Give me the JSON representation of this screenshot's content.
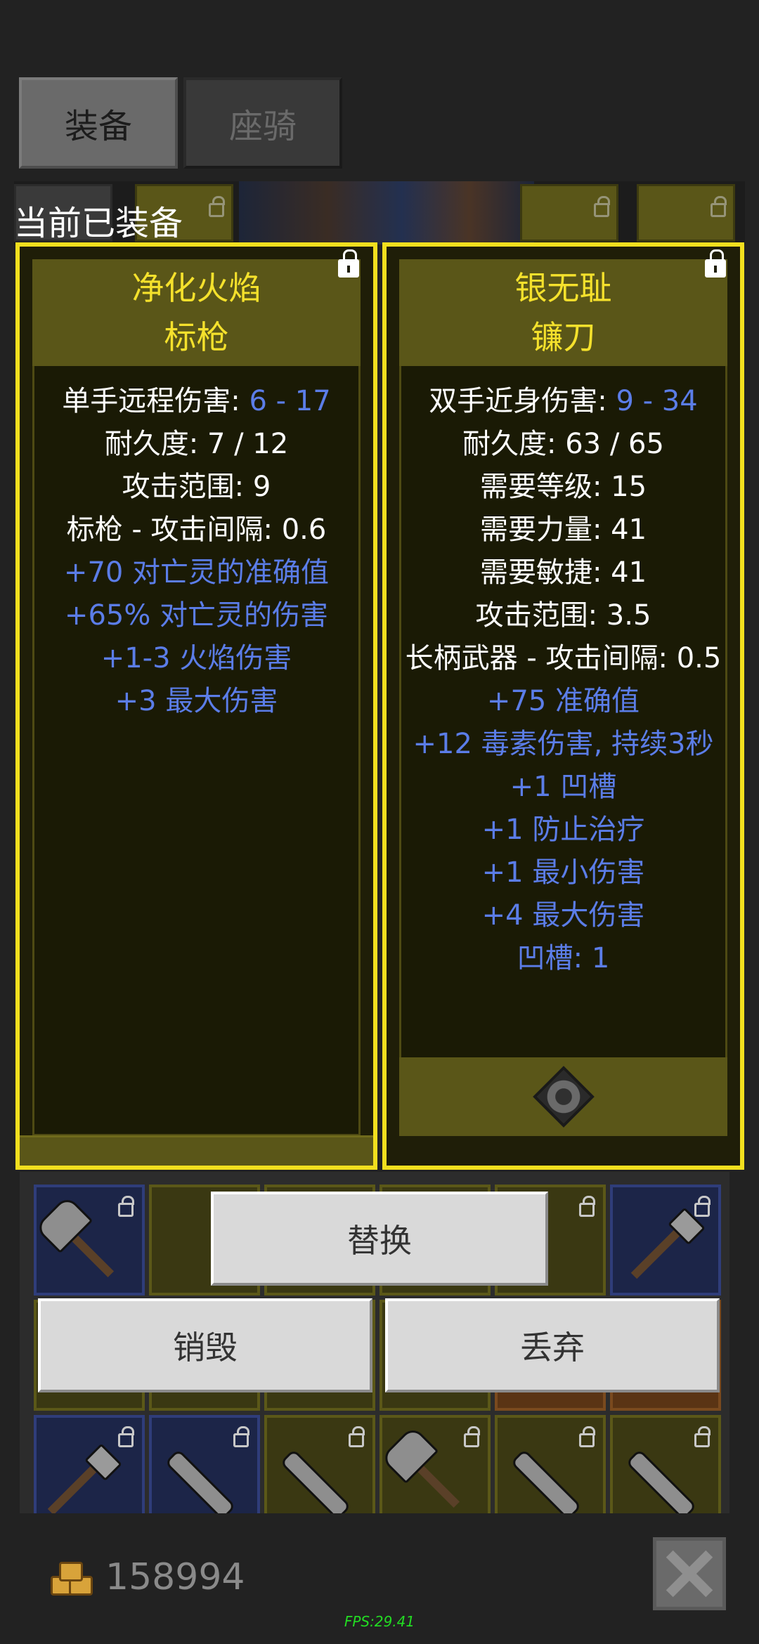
{
  "tabs": {
    "equipment": "装备",
    "mount": "座骑"
  },
  "current_equipped_label": "当前已装备",
  "left_item": {
    "name": "净化火焰",
    "type": "标枪",
    "stats": [
      {
        "label": "单手远程伤害: ",
        "value": "6 - 17"
      },
      {
        "label": "耐久度: 7 / 12"
      },
      {
        "label": "攻击范围: 9"
      },
      {
        "label": "标枪 - 攻击间隔: 0.6"
      }
    ],
    "bonuses": [
      "+70 对亡灵的准确值",
      "+65% 对亡灵的伤害",
      "+1-3 火焰伤害",
      "+3 最大伤害"
    ]
  },
  "right_item": {
    "name": "银无耻",
    "type": "镰刀",
    "stats": [
      {
        "label": "双手近身伤害: ",
        "value": "9 - 34"
      },
      {
        "label": "耐久度: 63 / 65"
      },
      {
        "label": "需要等级: 15"
      },
      {
        "label": "需要力量: 41"
      },
      {
        "label": "需要敏捷: 41"
      },
      {
        "label": "攻击范围: 3.5"
      },
      {
        "label": "长柄武器 - 攻击间隔: 0.5"
      }
    ],
    "bonuses": [
      "+75 准确值",
      "+12 毒素伤害, 持续3秒",
      "+1 凹槽",
      "+1 防止治疗",
      "+1 最小伤害",
      "+4 最大伤害",
      "凹槽: 1"
    ]
  },
  "buttons": {
    "replace": "替换",
    "destroy": "销毁",
    "discard": "丢弃"
  },
  "gold": "158994",
  "fps": "FPS:29.41",
  "colors": {
    "panel_border": "#f2df1e",
    "item_name": "#f5e12c",
    "bonus_text": "#5b7de8",
    "fps": "#22dd22"
  },
  "icons": [
    "lock-icon",
    "gold-coins-icon",
    "close-icon",
    "socket-gem-icon",
    "axe-icon",
    "spear-icon"
  ]
}
